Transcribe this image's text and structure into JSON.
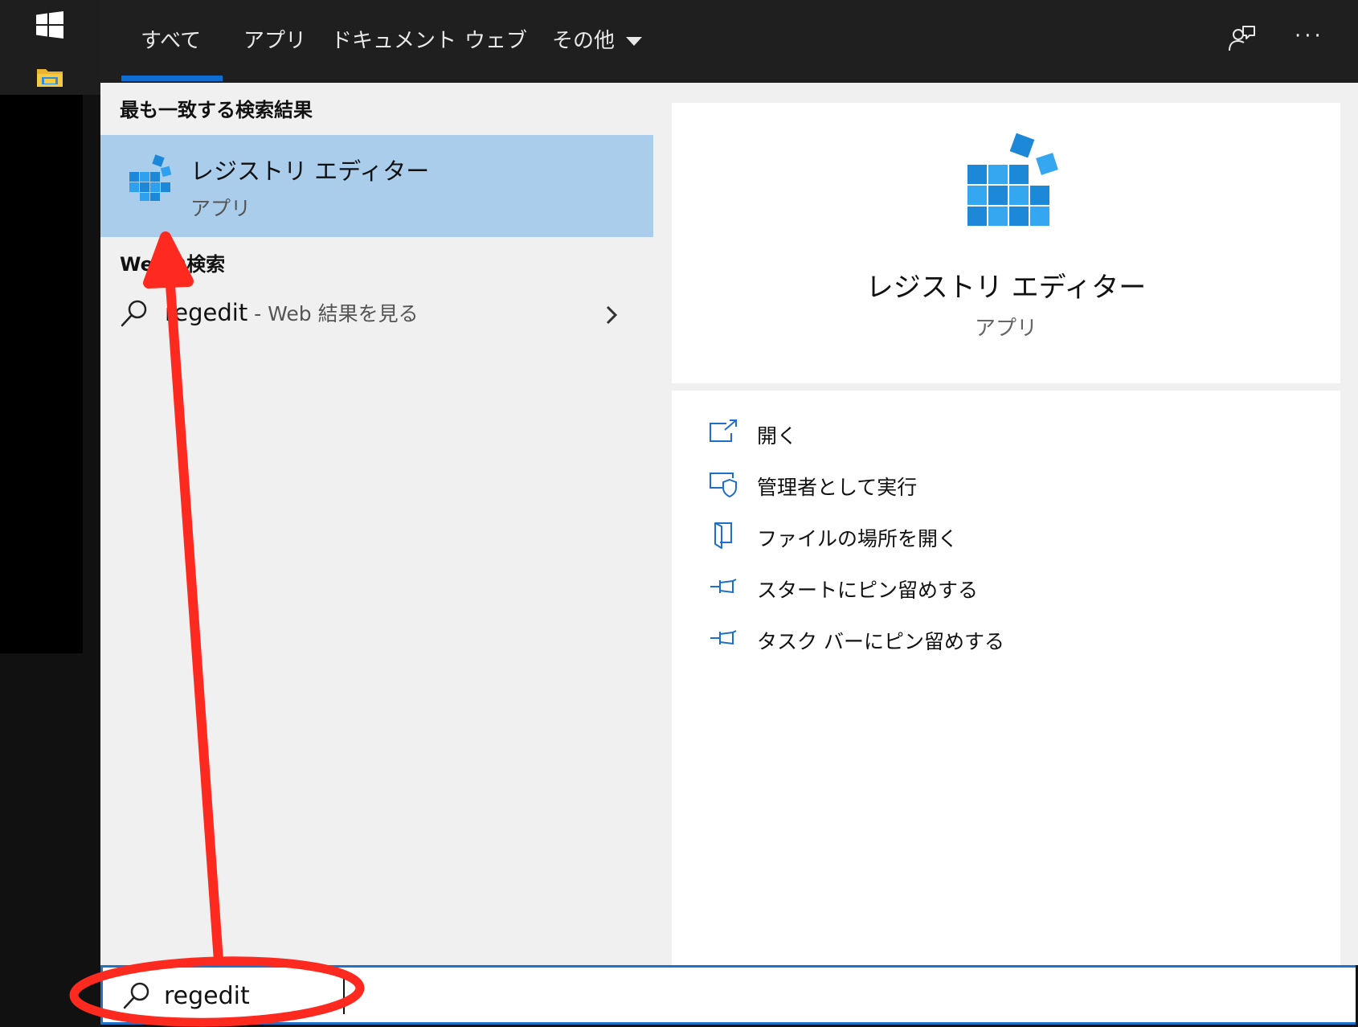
{
  "tabs": [
    {
      "label": "すべて"
    },
    {
      "label": "アプリ"
    },
    {
      "label": "ドキュメント"
    },
    {
      "label": "ウェブ"
    },
    {
      "label": "その他"
    }
  ],
  "active_tab": "すべて",
  "header_icons": [
    "feedback-icon",
    "more-icon"
  ],
  "more_label": "···",
  "best_match": {
    "section_title": "最も一致する検索結果",
    "name": "レジストリ エディター",
    "type": "アプリ",
    "icon": "registry-editor-icon"
  },
  "web_search": {
    "section_title": "Webの検索",
    "query": "regedit",
    "suffix": " - Web 結果を見る"
  },
  "preview": {
    "name": "レジストリ エディター",
    "type": "アプリ",
    "actions": [
      {
        "label": "開く",
        "icon": "open-icon"
      },
      {
        "label": "管理者として実行",
        "icon": "run-as-admin-icon"
      },
      {
        "label": "ファイルの場所を開く",
        "icon": "file-location-icon"
      },
      {
        "label": "スタートにピン留めする",
        "icon": "pin-icon"
      },
      {
        "label": "タスク バーにピン留めする",
        "icon": "pin-icon"
      }
    ]
  },
  "search": {
    "value": "regedit"
  },
  "colors": {
    "accent": "#0f6cd1",
    "selection": "#a9cdeb",
    "annotation": "#ff2a1f",
    "icon_blue": "#1e88d8"
  }
}
